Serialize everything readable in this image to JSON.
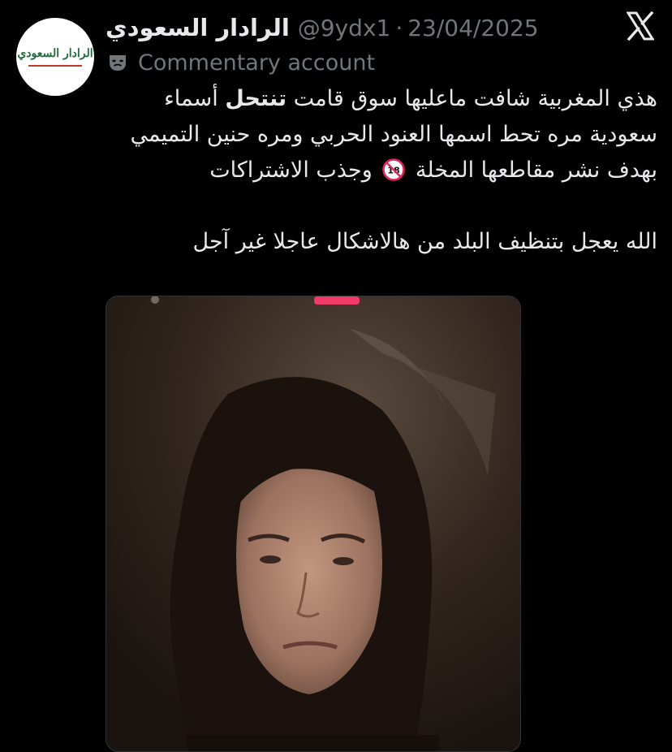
{
  "tweet": {
    "avatar_text": "الرادار السعودي",
    "display_name": "الرادار السعودي",
    "handle": "@9ydx1",
    "separator": "·",
    "date": "23/04/2025",
    "account_label": "Commentary account",
    "account_label_icon": "theater-mask-icon",
    "platform_icon": "x-logo-icon",
    "text_part1": "هذي المغربية شافت ماعليها سوق قامت ",
    "text_bold": "تنتحل",
    "text_part2": " أسماء سعودية مره تحط اسمها العنود الحربي ومره حنين التميمي بهدف نشر مقاطعها المخلة ",
    "text_emoji": "no-one-under-18-emoji",
    "text_part3": " وجذب الاشتراكات",
    "text_part4": "\n\nالله يعجل بتنظيف البلد من هالاشكال عاجلا غير آجل",
    "media_description_icon": "video-thumbnail"
  },
  "colors": {
    "background": "#000000",
    "primary_text": "#e7e9ea",
    "secondary_text": "#71767b",
    "avatar_green": "#1f6b3a",
    "avatar_red": "#c0392b",
    "live_pink": "#f23a66"
  }
}
